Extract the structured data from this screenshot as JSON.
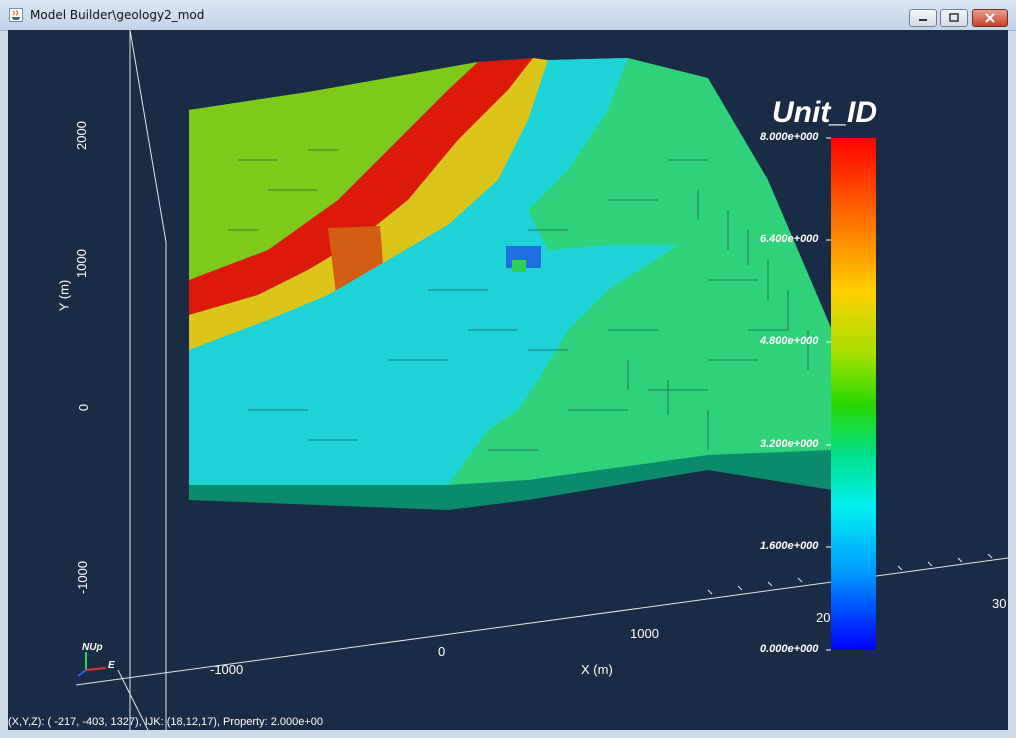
{
  "window": {
    "title": "Model Builder\\geology2_mod"
  },
  "axes": {
    "y_label": "Y (m)",
    "y_ticks": [
      "2000",
      "1000",
      "0",
      "-1000"
    ],
    "x_label": "X (m)",
    "x_ticks": [
      "-1000",
      "0",
      "1000",
      "30"
    ],
    "orientation": [
      "NUp",
      "E"
    ]
  },
  "legend": {
    "title": "Unit_ID",
    "ticks": [
      "8.000e+000",
      "6.400e+000",
      "4.800e+000",
      "3.200e+000",
      "1.600e+000",
      "0.000e+000"
    ],
    "colors": [
      "#ff0000",
      "#ff6a00",
      "#ffd000",
      "#28d800",
      "#00f0f0",
      "#0000ff"
    ]
  },
  "misc": {
    "stray_label": "20"
  },
  "status_bar": {
    "text": "(X,Y,Z): ( -217, -403, 1327), IJK: (18,12,17), Property: 2.000e+00"
  }
}
